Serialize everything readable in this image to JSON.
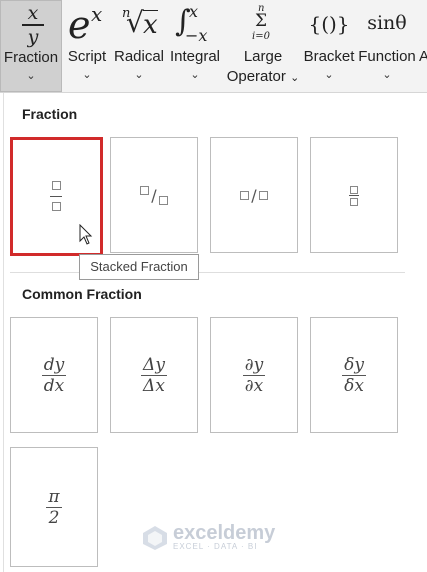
{
  "ribbon": {
    "buttons": [
      {
        "label": "Fraction",
        "icon": "fraction-icon",
        "symbol_num": "x",
        "symbol_den": "y",
        "has_dropdown": true,
        "selected": true
      },
      {
        "label": "Script",
        "icon": "script-icon",
        "symbol_base": "e",
        "symbol_sup": "x",
        "has_dropdown": true
      },
      {
        "label": "Radical",
        "icon": "radical-icon",
        "symbol_index": "n",
        "symbol_radicand": "x",
        "has_dropdown": true
      },
      {
        "label": "Integral",
        "icon": "integral-icon",
        "symbol_upper": "x",
        "symbol_lower": "−x",
        "has_dropdown": true
      },
      {
        "label_line1": "Large",
        "label_line2": "Operator",
        "icon": "large-operator-icon",
        "symbol_top": "n",
        "symbol_op": "Σ",
        "symbol_bottom": "i=0",
        "has_dropdown": true
      },
      {
        "label": "Bracket",
        "icon": "bracket-icon",
        "symbol": "{()}",
        "has_dropdown": true
      },
      {
        "label": "Function",
        "icon": "function-icon",
        "symbol": "sinθ",
        "has_dropdown": true
      },
      {
        "label": "A",
        "partial": true
      }
    ],
    "chevron": "⌄"
  },
  "gallery": {
    "sections": [
      {
        "title": "Fraction",
        "items": [
          {
            "name": "Stacked Fraction",
            "type": "stacked"
          },
          {
            "name": "Skewed Fraction",
            "type": "skewed"
          },
          {
            "name": "Linear Fraction",
            "type": "linear"
          },
          {
            "name": "Small Fraction",
            "type": "small"
          }
        ]
      },
      {
        "title": "Common Fraction",
        "items": [
          {
            "numerator": "dy",
            "denominator": "dx"
          },
          {
            "numerator": "Δy",
            "denominator": "Δx"
          },
          {
            "numerator": "∂y",
            "denominator": "∂x"
          },
          {
            "numerator": "δy",
            "denominator": "δx"
          },
          {
            "numerator": "π",
            "denominator": "2"
          }
        ]
      }
    ],
    "tooltip": "Stacked Fraction",
    "highlight_color": "#d12a2a"
  },
  "watermark": {
    "brand": "exceldemy",
    "tagline": "EXCEL · DATA · BI"
  }
}
